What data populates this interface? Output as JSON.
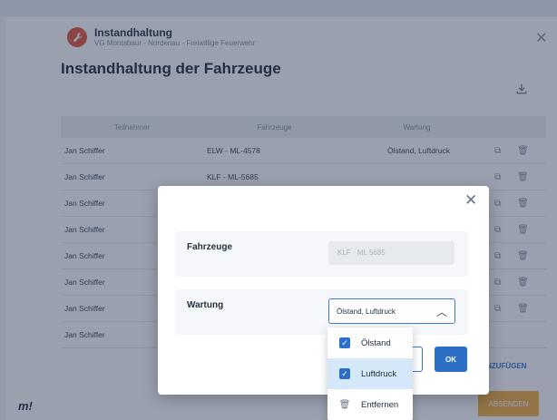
{
  "header": {
    "app_title": "Instandhaltung",
    "breadcrumb": "VG Montabaur - Nordenau - Freiwillige Feuerwehr",
    "page_title": "Instandhaltung der Fahrzeuge",
    "close_glyph": "✕"
  },
  "table": {
    "headers": [
      "Teilnehmer",
      "Fahrzeuge",
      "Wartung"
    ],
    "rows": [
      {
        "teilnehmer": "Jan Schiffer",
        "fahrzeuge": "ELW - ML-4578",
        "wartung": "Ölstand, Luftdruck"
      },
      {
        "teilnehmer": "Jan Schiffer",
        "fahrzeuge": "KLF - ML-5685",
        "wartung": ""
      },
      {
        "teilnehmer": "Jan Schiffer",
        "fahrzeuge": "",
        "wartung": ""
      },
      {
        "teilnehmer": "Jan Schiffer",
        "fahrzeuge": "",
        "wartung": ""
      },
      {
        "teilnehmer": "Jan Schiffer",
        "fahrzeuge": "",
        "wartung": ""
      },
      {
        "teilnehmer": "Jan Schiffer",
        "fahrzeuge": "",
        "wartung": ""
      },
      {
        "teilnehmer": "Jan Schiffer",
        "fahrzeuge": "",
        "wartung": ""
      },
      {
        "teilnehmer": "Jan Schiffer",
        "fahrzeuge": "",
        "wartung": ""
      }
    ]
  },
  "footer": {
    "add_label": "NZUFÜGEN",
    "send_label": "ABSENDEN",
    "logo": "m!"
  },
  "modal": {
    "close_glyph": "✕",
    "fahrzeuge_label": "Fahrzeuge",
    "fahrzeuge_value": "KLF · ML 5685",
    "wartung_label": "Wartung",
    "wartung_value": "Ölstand, Luftdruck",
    "ok_label": "OK"
  },
  "dropdown": {
    "options": [
      {
        "label": "Ölstand",
        "checked": true
      },
      {
        "label": "Luftdruck",
        "checked": true
      },
      {
        "label": "Entfernen",
        "checked": false
      }
    ]
  },
  "colors": {
    "accent": "#2d6fc6",
    "send": "#f0b043",
    "brand_icon": "#e55a44"
  }
}
